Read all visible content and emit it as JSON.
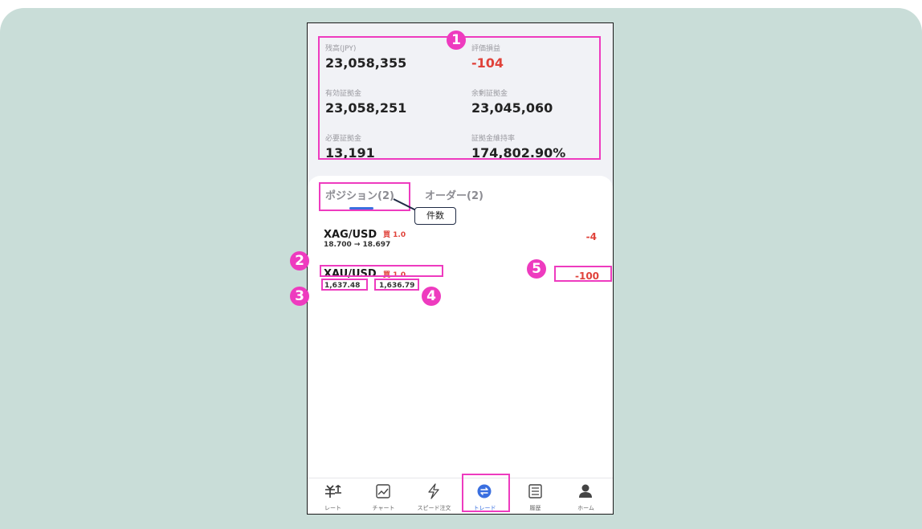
{
  "summary": {
    "balance": {
      "label": "残高(JPY)",
      "value": "23,058,355"
    },
    "unrealized_pl": {
      "label": "評価損益",
      "value": "-104"
    },
    "effective_margin": {
      "label": "有効証拠金",
      "value": "23,058,251"
    },
    "free_margin": {
      "label": "余剰証拠金",
      "value": "23,045,060"
    },
    "required_margin": {
      "label": "必要証拠金",
      "value": "13,191"
    },
    "margin_ratio": {
      "label": "証拠金維持率",
      "value": "174,802.90%"
    }
  },
  "tabs": [
    {
      "label": "ポジション(2)",
      "active": true
    },
    {
      "label": "オーダー(2)",
      "active": false
    }
  ],
  "callout": "件数",
  "positions": [
    {
      "symbol": "XAG/USD",
      "side": "買 1.0",
      "prices": "18.700 → 18.697",
      "pl": "-4"
    },
    {
      "symbol": "XAU/USD",
      "side": "買 1.0",
      "open_price": "1,637.48",
      "current_price": "1,636.79",
      "pl": "-100"
    }
  ],
  "tabbar": [
    {
      "label": "レート",
      "icon": "rate-icon"
    },
    {
      "label": "チャート",
      "icon": "chart-icon"
    },
    {
      "label": "スピード注文",
      "icon": "lightning-icon"
    },
    {
      "label": "トレード",
      "icon": "trade-icon",
      "active": true
    },
    {
      "label": "履歴",
      "icon": "history-list-icon"
    },
    {
      "label": "ホーム",
      "icon": "person-icon"
    }
  ],
  "annotations": [
    "1",
    "2",
    "3",
    "4",
    "5"
  ],
  "colors": {
    "accent": "#3a6fe0",
    "loss": "#e0423a",
    "highlight": "#ee3bbf",
    "background": "#c9ddd8"
  }
}
